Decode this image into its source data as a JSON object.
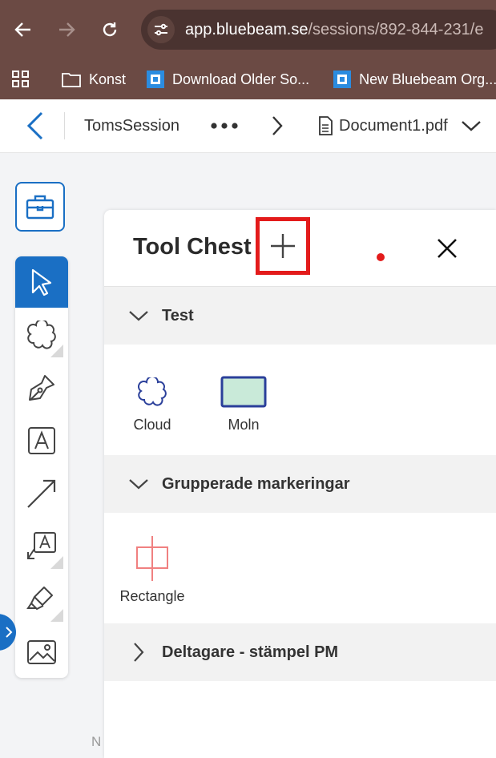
{
  "browser": {
    "url_host": "app.bluebeam.se",
    "url_path": "/sessions/892-844-231/e",
    "bookmarks": [
      {
        "label": "Konst",
        "icon": "folder-icon"
      },
      {
        "label": "Download Older So...",
        "icon": "bluebeam-icon"
      },
      {
        "label": "New Bluebeam Org...",
        "icon": "bluebeam-icon"
      }
    ]
  },
  "header": {
    "session_name": "TomsSession",
    "document_name": "Document1.pdf"
  },
  "tool_chest": {
    "title": "Tool Chest",
    "sections": [
      {
        "label": "Test",
        "expanded": true,
        "items": [
          {
            "label": "Cloud",
            "icon": "cloud-icon"
          },
          {
            "label": "Moln",
            "icon": "rectangle-fill-icon"
          }
        ]
      },
      {
        "label": "Grupperade markeringar",
        "expanded": true,
        "items": [
          {
            "label": "Rectangle",
            "icon": "rectangle-cross-icon"
          }
        ]
      },
      {
        "label": "Deltagare - stämpel PM",
        "expanded": false,
        "items": []
      }
    ]
  },
  "bottom_hint": "N",
  "colors": {
    "accent": "#1a6fc4",
    "highlight_red": "#e31b1b",
    "chrome": "#6b4a44"
  }
}
